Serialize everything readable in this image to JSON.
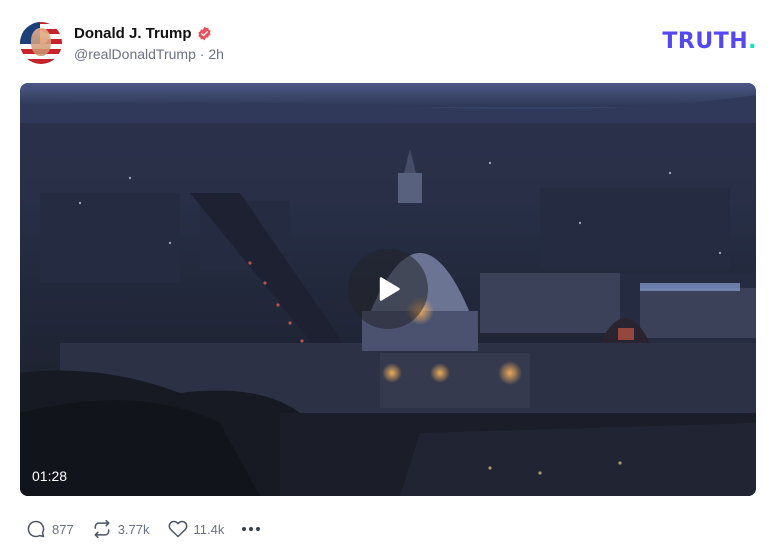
{
  "author": {
    "display_name": "Donald J. Trump",
    "handle": "@realDonaldTrump",
    "separator": "·",
    "time": "2h",
    "verified_icon": "verified-badge-icon",
    "verified_color": "#e8505b"
  },
  "brand": {
    "name": "TRUTH",
    "dot": ".",
    "color": "#5448ee",
    "dot_color": "#17e1c3"
  },
  "media": {
    "type": "video",
    "duration": "01:28",
    "play_icon": "play-icon"
  },
  "actions": {
    "reply_count": "877",
    "retruth_count": "3.77k",
    "like_count": "11.4k",
    "reply_icon": "reply-icon",
    "retruth_icon": "retruth-icon",
    "like_icon": "heart-icon",
    "more_icon": "more-horizontal-icon"
  }
}
